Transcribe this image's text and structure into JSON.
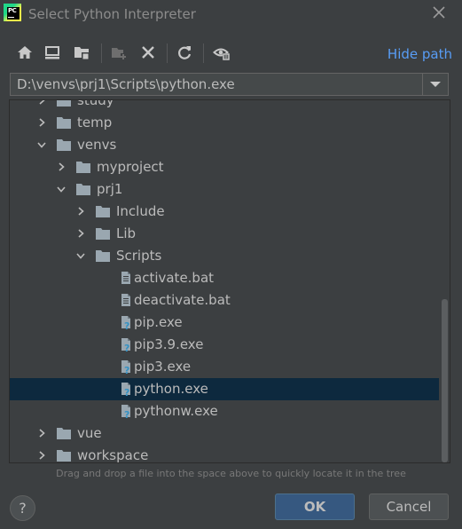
{
  "window": {
    "title": "Select Python Interpreter",
    "app_icon_text": "PC"
  },
  "toolbar": {
    "hide_path_label": "Hide path",
    "icons": [
      "home-icon",
      "desktop-icon",
      "project-icon",
      "new-folder-icon",
      "delete-icon",
      "refresh-icon",
      "show-hidden-icon"
    ]
  },
  "path": {
    "value": "D:\\venvs\\prj1\\Scripts\\python.exe"
  },
  "tree": {
    "rows": [
      {
        "label": "study",
        "kind": "folder",
        "level": 0,
        "expanded": false
      },
      {
        "label": "temp",
        "kind": "folder",
        "level": 0,
        "expanded": false
      },
      {
        "label": "venvs",
        "kind": "folder",
        "level": 0,
        "expanded": true
      },
      {
        "label": "myproject",
        "kind": "folder",
        "level": 1,
        "expanded": false
      },
      {
        "label": "prj1",
        "kind": "folder",
        "level": 1,
        "expanded": true
      },
      {
        "label": "Include",
        "kind": "folder",
        "level": 2,
        "expanded": false
      },
      {
        "label": "Lib",
        "kind": "folder",
        "level": 2,
        "expanded": false
      },
      {
        "label": "Scripts",
        "kind": "folder",
        "level": 2,
        "expanded": true
      },
      {
        "label": "activate.bat",
        "kind": "file",
        "level": 3
      },
      {
        "label": "deactivate.bat",
        "kind": "file",
        "level": 3
      },
      {
        "label": "pip.exe",
        "kind": "exe",
        "level": 3
      },
      {
        "label": "pip3.9.exe",
        "kind": "exe",
        "level": 3
      },
      {
        "label": "pip3.exe",
        "kind": "exe",
        "level": 3
      },
      {
        "label": "python.exe",
        "kind": "exe",
        "level": 3,
        "selected": true
      },
      {
        "label": "pythonw.exe",
        "kind": "exe",
        "level": 3
      },
      {
        "label": "vue",
        "kind": "folder",
        "level": 0,
        "expanded": false
      },
      {
        "label": "workspace",
        "kind": "folder",
        "level": 0,
        "expanded": false
      }
    ]
  },
  "hint": "Drag and drop a file into the space above to quickly locate it in the tree",
  "buttons": {
    "help": "?",
    "ok": "OK",
    "cancel": "Cancel"
  },
  "colors": {
    "background": "#3c3f41",
    "selection": "#0d293e",
    "accent_link": "#589df6",
    "ok_button": "#365880"
  }
}
